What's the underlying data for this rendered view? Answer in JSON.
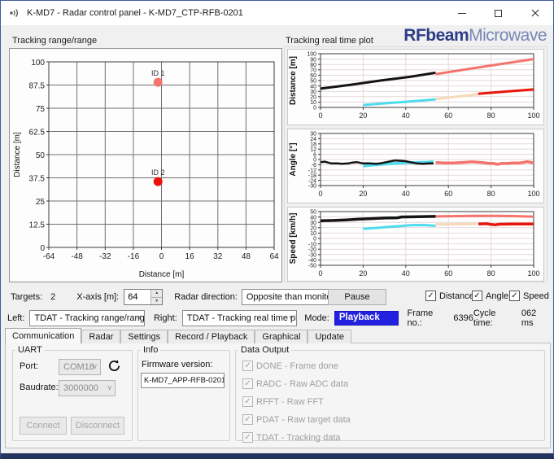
{
  "window": {
    "title": "K-MD7 - Radar control panel - K-MD7_CTP-RFB-0201",
    "logo": {
      "brand": "RFbeam",
      "suffix": "Microwave"
    }
  },
  "colors": {
    "selection_blue": "#2121df",
    "logo_dark": "#2c3d87",
    "logo_light": "#7787b5",
    "track_black": "#141414",
    "track_salmon": "#f4756d",
    "track_cyan": "#4ddcee",
    "track_peach": "#f7d9ba",
    "track_red": "#e8170c"
  },
  "icons": {
    "check_glyph": "✓",
    "chevron_down": "∨",
    "spinner_up": "▲",
    "spinner_down": "▼",
    "help_glyph": "?",
    "close_glyph": "✕"
  },
  "left_panel": {
    "title": "Tracking range/range"
  },
  "right_panel": {
    "title": "Tracking real time plot"
  },
  "controls": {
    "targets_label": "Targets:",
    "targets_value": "2",
    "xaxis_label": "X-axis [m]:",
    "xaxis_value": "64",
    "radar_direction_label": "Radar direction:",
    "radar_direction_value": "Opposite than monito",
    "pause_label": "Pause",
    "checkboxes": [
      {
        "label": "Distance",
        "checked": true
      },
      {
        "label": "Angle",
        "checked": true
      },
      {
        "label": "Speed",
        "checked": true
      }
    ]
  },
  "mode_row": {
    "left_label": "Left:",
    "left_value": "TDAT - Tracking range/range",
    "right_label": "Right:",
    "right_value": "TDAT - Tracking real time plot",
    "mode_label": "Mode:",
    "mode_value": "Playback",
    "frame_label": "Frame no.:",
    "frame_value": "6396",
    "cycle_label": "Cycle time:",
    "cycle_value": "062 ms"
  },
  "tabs": [
    {
      "label": "Communication",
      "active": true
    },
    {
      "label": "Radar",
      "active": false
    },
    {
      "label": "Settings",
      "active": false
    },
    {
      "label": "Record / Playback",
      "active": false
    },
    {
      "label": "Graphical",
      "active": false
    },
    {
      "label": "Update",
      "active": false
    }
  ],
  "uart": {
    "title": "UART",
    "port_label": "Port:",
    "port_value": "COM18",
    "baudrate_label": "Baudrate:",
    "baudrate_value": "3000000",
    "connect_label": "Connect",
    "disconnect_label": "Disconnect"
  },
  "info": {
    "title": "Info",
    "firmware_label": "Firmware version:",
    "firmware_value": "K-MD7_APP-RFB-0201"
  },
  "data_output": {
    "title": "Data Output",
    "items": [
      {
        "label": "DONE - Frame done",
        "checked": true
      },
      {
        "label": "RADC - Raw ADC data",
        "checked": true
      },
      {
        "label": "RFFT - Raw FFT",
        "checked": true
      },
      {
        "label": "PDAT - Raw target data",
        "checked": true
      },
      {
        "label": "TDAT - Tracking data",
        "checked": true
      }
    ]
  },
  "chart_data": [
    {
      "id": "range-chart",
      "type": "scatter",
      "title": "Tracking range/range",
      "xlabel": "Distance [m]",
      "ylabel": "Distance [m]",
      "xlim": [
        -64,
        64
      ],
      "ylim": [
        0,
        100
      ],
      "xticks": [
        -64,
        -48,
        -32,
        -16,
        0,
        16,
        32,
        48,
        64
      ],
      "yticks": [
        0,
        12.5,
        25,
        37.5,
        50,
        62.5,
        75,
        87.5,
        100
      ],
      "grid": true,
      "grid_color": "#6f6f6f",
      "axis_color": "#3a3a3a",
      "plot_bg": "#fdfdfd",
      "ytick_font": 10,
      "xtick_font": 10,
      "ylabel_x": 12,
      "points": [
        {
          "label": "ID 1",
          "x": -2,
          "y": 89,
          "color": "#f4756d"
        },
        {
          "label": "ID 2",
          "x": -2,
          "y": 35.5,
          "color": "#ea1208"
        }
      ]
    },
    {
      "id": "distance-chart",
      "type": "line",
      "ylabel": "Distance [m]",
      "ylabel_bold": true,
      "xlim": [
        0,
        100
      ],
      "ylim": [
        0,
        100
      ],
      "xticks": [
        0,
        20,
        40,
        60,
        80,
        100
      ],
      "yticks": [
        0,
        10,
        20,
        30,
        40,
        50,
        60,
        70,
        80,
        90,
        100
      ],
      "grid": true,
      "grid_color": "#e6d7d7",
      "axis_color": "#3a3a3a",
      "plot_bg": "#ffffff",
      "ytick_font": 7,
      "xtick_font": 9,
      "ylabel_x": 9,
      "series": [
        {
          "name": "target2-history",
          "color": "#4ddcee",
          "width": 3,
          "points": [
            [
              20,
              4.5
            ],
            [
              30,
              7.5
            ],
            [
              40,
              10.5
            ],
            [
              54,
              15
            ]
          ]
        },
        {
          "name": "target2-coast",
          "color": "#f7d9ba",
          "width": 3,
          "points": [
            [
              54,
              15.5
            ],
            [
              64,
              20
            ],
            [
              74,
              24.5
            ]
          ]
        },
        {
          "name": "target1-history",
          "color": "#141414",
          "width": 3,
          "points": [
            [
              0,
              35
            ],
            [
              14,
              42
            ],
            [
              28,
              50
            ],
            [
              42,
              57
            ],
            [
              54,
              64.5
            ]
          ]
        },
        {
          "name": "target1-live",
          "color": "#f4756d",
          "width": 3,
          "points": [
            [
              54,
              62
            ],
            [
              70,
              72
            ],
            [
              85,
              81
            ],
            [
              100,
              90
            ]
          ]
        },
        {
          "name": "target2-live",
          "color": "#e8170c",
          "width": 3,
          "points": [
            [
              74,
              25.5
            ],
            [
              87,
              29.5
            ],
            [
              100,
              33.5
            ]
          ]
        }
      ]
    },
    {
      "id": "angle-chart",
      "type": "line",
      "ylabel": "Angle [°]",
      "ylabel_bold": true,
      "xlim": [
        0,
        100
      ],
      "ylim": [
        -30,
        30
      ],
      "xticks": [
        0,
        20,
        40,
        60,
        80,
        100
      ],
      "yticks": [
        30,
        24,
        18,
        12,
        6,
        0,
        -6,
        -12,
        -18,
        -24,
        -30
      ],
      "grid": true,
      "grid_color": "#e6d7d7",
      "axis_color": "#3a3a3a",
      "plot_bg": "#ffffff",
      "ytick_font": 7,
      "xtick_font": 9,
      "ylabel_x": 9,
      "series": [
        {
          "name": "target2-history",
          "color": "#4ddcee",
          "width": 3.5,
          "points": [
            [
              20,
              -7.5
            ],
            [
              26,
              -6
            ],
            [
              32,
              -5
            ],
            [
              38,
              -4
            ],
            [
              44,
              -3.5
            ],
            [
              50,
              -3
            ],
            [
              53,
              -2.5
            ]
          ]
        },
        {
          "name": "target1-history",
          "color": "#141414",
          "width": 2.5,
          "points": [
            [
              0,
              -3
            ],
            [
              2,
              -2.5
            ],
            [
              5,
              -4.5
            ],
            [
              8,
              -4.5
            ],
            [
              10,
              -5
            ],
            [
              13,
              -4.5
            ],
            [
              15,
              -3.5
            ],
            [
              17,
              -3
            ],
            [
              20,
              -4.5
            ],
            [
              23,
              -4.5
            ],
            [
              26,
              -5
            ],
            [
              28,
              -4.5
            ],
            [
              30,
              -3.5
            ],
            [
              33,
              -2
            ],
            [
              35,
              -1
            ],
            [
              38,
              -1.5
            ],
            [
              40,
              -2
            ],
            [
              42,
              -3
            ],
            [
              45,
              -4.5
            ],
            [
              48,
              -5
            ],
            [
              51,
              -4.5
            ],
            [
              53,
              -4.5
            ]
          ]
        },
        {
          "name": "target-live",
          "color": "#f2736b",
          "width": 3.5,
          "points": [
            [
              54,
              -3.5
            ],
            [
              58,
              -4
            ],
            [
              62,
              -4
            ],
            [
              66,
              -3.5
            ],
            [
              69,
              -3
            ],
            [
              71,
              -2.5
            ],
            [
              73,
              -3
            ],
            [
              76,
              -3.5
            ],
            [
              79,
              -4.5
            ],
            [
              81,
              -4.5
            ],
            [
              83,
              -5.5
            ],
            [
              85,
              -4.5
            ],
            [
              88,
              -4.5
            ],
            [
              90,
              -4
            ],
            [
              93,
              -4
            ],
            [
              95,
              -3.5
            ],
            [
              97,
              -2.5
            ],
            [
              99,
              -3.5
            ],
            [
              100,
              -3.5
            ]
          ]
        }
      ]
    },
    {
      "id": "speed-chart",
      "type": "line",
      "ylabel": "Speed [km/h]",
      "ylabel_bold": true,
      "xlim": [
        0,
        100
      ],
      "ylim": [
        -50,
        50
      ],
      "xticks": [
        0,
        20,
        40,
        60,
        80,
        100
      ],
      "yticks": [
        50,
        40,
        30,
        20,
        10,
        0,
        -10,
        -20,
        -30,
        -40,
        -50
      ],
      "grid": true,
      "grid_color": "#e6d7d7",
      "axis_color": "#3a3a3a",
      "plot_bg": "#ffffff",
      "ytick_font": 7,
      "xtick_font": 9,
      "ylabel_x": 9,
      "series": [
        {
          "name": "target2-history",
          "color": "#4ddcee",
          "width": 3,
          "points": [
            [
              20,
              18
            ],
            [
              26,
              19.5
            ],
            [
              32,
              21.5
            ],
            [
              38,
              23
            ],
            [
              42,
              24.5
            ],
            [
              46,
              25
            ],
            [
              50,
              24.5
            ],
            [
              54,
              23.5
            ]
          ]
        },
        {
          "name": "target2-coast",
          "color": "#f7d9ba",
          "width": 3,
          "points": [
            [
              54,
              26
            ],
            [
              64,
              26.5
            ],
            [
              73,
              27
            ]
          ]
        },
        {
          "name": "target1-history",
          "color": "#141414",
          "width": 3.5,
          "points": [
            [
              0,
              33
            ],
            [
              6,
              33.5
            ],
            [
              12,
              34.5
            ],
            [
              18,
              36
            ],
            [
              24,
              37
            ],
            [
              30,
              38
            ],
            [
              36,
              38.5
            ],
            [
              38,
              40
            ],
            [
              46,
              40.5
            ],
            [
              54,
              41
            ]
          ]
        },
        {
          "name": "target1-live",
          "color": "#f4756d",
          "width": 3,
          "points": [
            [
              54,
              41
            ],
            [
              62,
              41.5
            ],
            [
              72,
              42
            ],
            [
              82,
              42
            ],
            [
              92,
              41.5
            ],
            [
              100,
              40.5
            ]
          ]
        },
        {
          "name": "target2-live",
          "color": "#e8170c",
          "width": 3.5,
          "points": [
            [
              74,
              27
            ],
            [
              78,
              27.5
            ],
            [
              80,
              26
            ],
            [
              82,
              25.5
            ],
            [
              84,
              26.5
            ],
            [
              90,
              27
            ],
            [
              100,
              27
            ]
          ]
        }
      ]
    }
  ]
}
